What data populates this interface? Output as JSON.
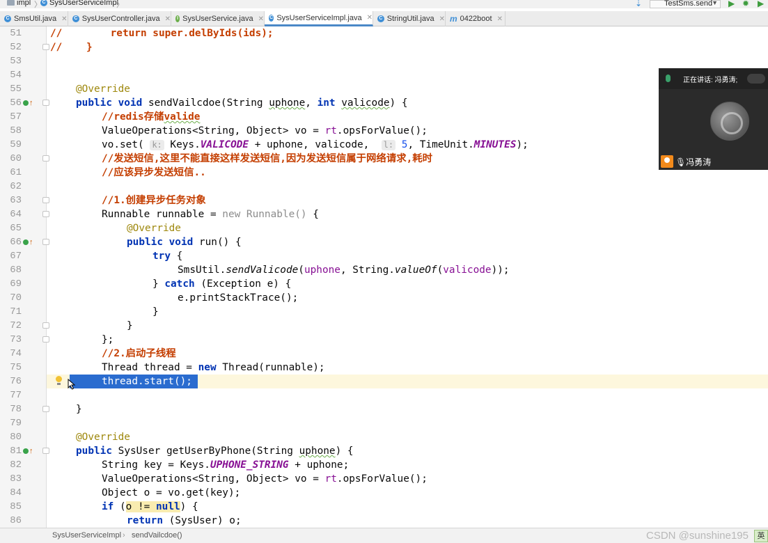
{
  "nav": {
    "crumbs": [
      "impl",
      "SysUserServiceImpl"
    ],
    "run_config": "TestSms.send"
  },
  "tabs": [
    {
      "label": "SmsUtil.java",
      "icon": "class-icon"
    },
    {
      "label": "SysUserController.java",
      "icon": "class-icon"
    },
    {
      "label": "SysUserService.java",
      "icon": "interface-icon"
    },
    {
      "label": "SysUserServiceImpl.java",
      "icon": "class-icon",
      "active": true
    },
    {
      "label": "StringUtil.java",
      "icon": "class-icon"
    },
    {
      "label": "0422boot",
      "icon": "module-icon"
    }
  ],
  "editor": {
    "line_numbers": [
      "51",
      "52",
      "53",
      "54",
      "55",
      "56",
      "57",
      "58",
      "59",
      "60",
      "61",
      "62",
      "63",
      "64",
      "65",
      "66",
      "67",
      "68",
      "69",
      "70",
      "71",
      "72",
      "73",
      "74",
      "75",
      "76",
      "77",
      "78",
      "79",
      "80",
      "81",
      "82",
      "83",
      "84",
      "85",
      "86"
    ],
    "current_line": "76",
    "inlay_hints": {
      "k": "k:",
      "l": "l:"
    }
  },
  "video_overlay": {
    "speaking_label": "正在讲话: 冯勇涛;",
    "speaker_name": "冯勇涛"
  },
  "statusbar": {
    "crumbs": [
      "SysUserServiceImpl",
      "sendVailcdoe()"
    ],
    "watermark": "CSDN @sunshine195",
    "ime": "英"
  },
  "colors": {
    "keyword": "#0033b3",
    "comment": "#c43e00",
    "annotation": "#9e880d",
    "field": "#871094",
    "selection": "#2a6ccf",
    "current_line": "#fdf7dd"
  }
}
